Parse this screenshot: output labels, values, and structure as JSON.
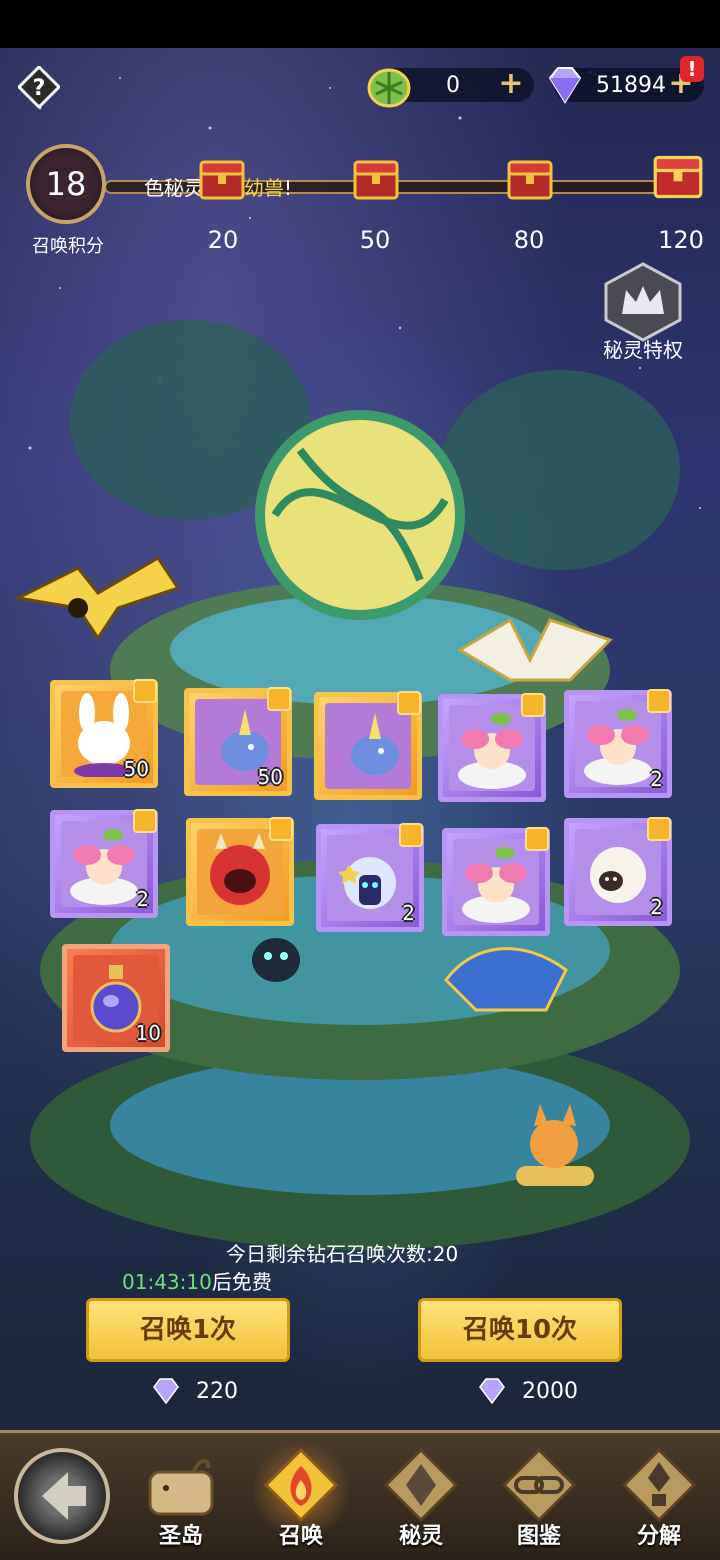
{
  "resources": {
    "leaf_currency": "0",
    "diamond_currency": "51894",
    "alert_mark": "!"
  },
  "summon_points": {
    "value": "18",
    "label": "召唤积分",
    "marquee_prefix": "色秘灵",
    "marquee_highlight": "暗影幼兽",
    "marquee_suffix": "!",
    "progress": 0.15,
    "milestones": [
      "20",
      "50",
      "80",
      "120"
    ]
  },
  "privilege": {
    "label": "秘灵特权"
  },
  "rewards": [
    {
      "quantity": "50",
      "rarity": "gold",
      "icon": "white-rabbit-creature"
    },
    {
      "quantity": "50",
      "rarity": "gold",
      "icon": "unicorn-dragon"
    },
    {
      "quantity": "",
      "rarity": "gold",
      "icon": "unicorn-dragon"
    },
    {
      "quantity": "",
      "rarity": "purple",
      "icon": "flower-sprout-creature"
    },
    {
      "quantity": "2",
      "rarity": "purple",
      "icon": "flower-sprout-creature"
    },
    {
      "quantity": "2",
      "rarity": "purple",
      "icon": "flower-sprout-creature"
    },
    {
      "quantity": "",
      "rarity": "gold",
      "icon": "red-horned-monster"
    },
    {
      "quantity": "2",
      "rarity": "purple",
      "icon": "cloud-bunny"
    },
    {
      "quantity": "",
      "rarity": "purple",
      "icon": "flower-sprout-creature"
    },
    {
      "quantity": "2",
      "rarity": "purple",
      "icon": "fluffy-sheep"
    },
    {
      "quantity": "10",
      "rarity": "red",
      "icon": "potion-flask"
    }
  ],
  "summon_info": {
    "remaining_text": "今日剩余钻石召唤次数:20",
    "timer": "01:43:10",
    "timer_suffix": "后免费"
  },
  "buttons": {
    "summon_once": "召唤1次",
    "summon_ten": "召唤10次",
    "cost_once": "220",
    "cost_ten": "2000"
  },
  "nav": [
    {
      "label": "圣岛",
      "icon": "whale-island-icon"
    },
    {
      "label": "召唤",
      "icon": "summon-flame-icon",
      "active": true
    },
    {
      "label": "秘灵",
      "icon": "spirit-diamond-icon"
    },
    {
      "label": "图鉴",
      "icon": "chain-link-icon"
    },
    {
      "label": "分解",
      "icon": "decompose-gem-icon"
    }
  ],
  "colors": {
    "accent_gold": "#f2c238",
    "highlight_yellow": "#f4d24a",
    "timer_green": "#6fe07a",
    "alert_red": "#e0262a"
  }
}
